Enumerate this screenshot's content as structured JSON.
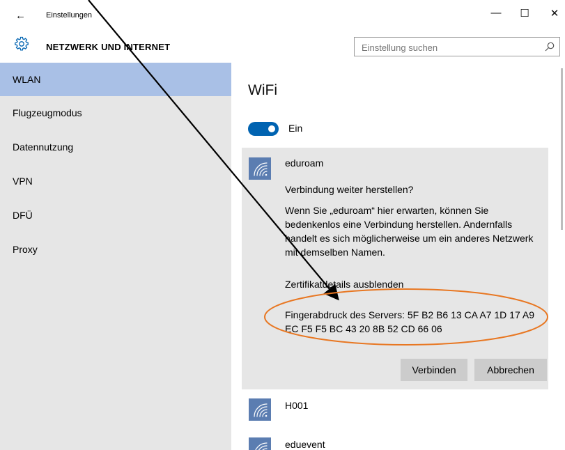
{
  "window": {
    "back_glyph": "←",
    "title": "Einstellungen",
    "minimize_glyph": "—",
    "maximize_glyph": "☐",
    "close_glyph": "✕"
  },
  "header": {
    "section_title": "NETZWERK UND INTERNET",
    "search_placeholder": "Einstellung suchen"
  },
  "sidebar": {
    "items": [
      {
        "label": "WLAN",
        "active": true
      },
      {
        "label": "Flugzeugmodus"
      },
      {
        "label": "Datennutzung"
      },
      {
        "label": "VPN"
      },
      {
        "label": "DFÜ"
      },
      {
        "label": "Proxy"
      }
    ]
  },
  "main": {
    "title": "WiFi",
    "wifi_toggle": {
      "state": "on",
      "label": "Ein"
    },
    "expanded_network": {
      "name": "eduroam",
      "question": "Verbindung weiter herstellen?",
      "explanation": "Wenn Sie „eduroam“ hier erwarten, können Sie bedenkenlos eine Verbindung herstellen. Andernfalls handelt es sich möglicherweise um ein anderes Netzwerk mit demselben Namen.",
      "cert_toggle": "Zertifikatdetails ausblenden",
      "fingerprint": "Fingerabdruck des Servers: 5F B2 B6 13 CA A7 1D 17 A9 EC F5 F5 BC 43 20 8B 52 CD 66 06",
      "connect_label": "Verbinden",
      "cancel_label": "Abbrechen"
    },
    "other_networks": [
      {
        "name": "H001"
      },
      {
        "name": "eduevent"
      }
    ]
  },
  "colors": {
    "accent": "#0063b1",
    "sidebar_selected": "#a9c0e6",
    "annotation_ellipse": "#e87722",
    "annotation_arrow": "#000000"
  },
  "icons": {
    "settings": "gear-icon",
    "search": "search-icon",
    "network": "wifi-signal-icon"
  }
}
